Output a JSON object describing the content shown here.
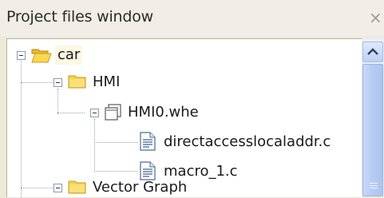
{
  "window": {
    "title": "Project files window",
    "close_glyph": "×"
  },
  "tree": {
    "nodes": [
      {
        "label": "car",
        "icon": "open-folder-icon",
        "level": 0,
        "expanded": true,
        "selected": true
      },
      {
        "label": "HMI",
        "icon": "folder-icon",
        "level": 1,
        "expanded": true
      },
      {
        "label": "HMI0.whe",
        "icon": "window-file-icon",
        "level": 2,
        "expanded": true
      },
      {
        "label": "directaccesslocaladdr.c",
        "icon": "source-file-icon",
        "level": 3
      },
      {
        "label": "macro_1.c",
        "icon": "source-file-icon",
        "level": 3
      },
      {
        "label": "Vector Graph",
        "icon": "folder-icon",
        "level": 1,
        "expanded": true
      }
    ]
  },
  "colors": {
    "folder": "#f6d24a",
    "selection": "#fbf8e3",
    "scrollbar": "#b6cbf1"
  }
}
